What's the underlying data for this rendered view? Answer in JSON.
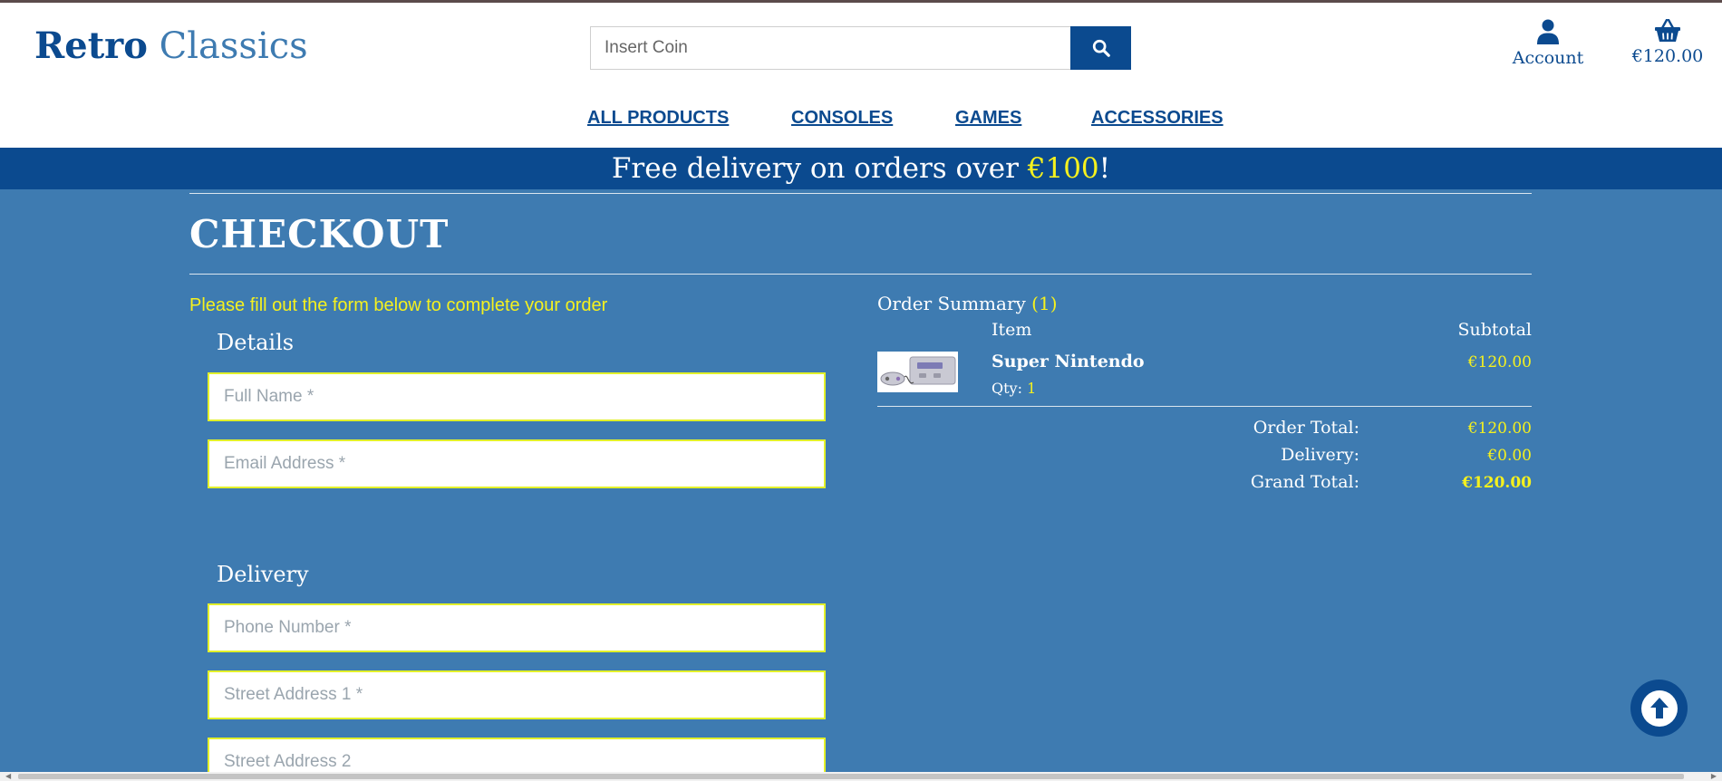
{
  "brand": {
    "part1": "Retro",
    "part2": "Classics"
  },
  "search": {
    "placeholder": "Insert Coin"
  },
  "account": {
    "label": "Account"
  },
  "bag": {
    "total": "€120.00"
  },
  "nav": [
    {
      "label": "ALL PRODUCTS"
    },
    {
      "label": "CONSOLES"
    },
    {
      "label": "GAMES"
    },
    {
      "label": "ACCESSORIES"
    }
  ],
  "banner": {
    "prefix": "Free delivery on orders over ",
    "amount": "€100",
    "suffix": "!"
  },
  "checkout": {
    "title": "CHECKOUT",
    "note": "Please fill out the form below to complete your order",
    "details_heading": "Details",
    "delivery_heading": "Delivery",
    "fields": {
      "full_name": "Full Name *",
      "email": "Email Address *",
      "phone": "Phone Number *",
      "street1": "Street Address 1 *",
      "street2": "Street Address 2"
    }
  },
  "summary": {
    "heading": "Order Summary",
    "count": "(1)",
    "col_item": "Item",
    "col_subtotal": "Subtotal",
    "items": [
      {
        "name": "Super Nintendo",
        "qty_label": "Qty:",
        "qty": "1",
        "subtotal": "€120.00"
      }
    ],
    "order_total_label": "Order Total:",
    "order_total": "€120.00",
    "delivery_label": "Delivery:",
    "delivery": "€0.00",
    "grand_total_label": "Grand Total:",
    "grand_total": "€120.00"
  },
  "colors": {
    "brand": "#0b4a8f",
    "page_bg": "#3e7bb1",
    "accent": "#f5f11e"
  }
}
